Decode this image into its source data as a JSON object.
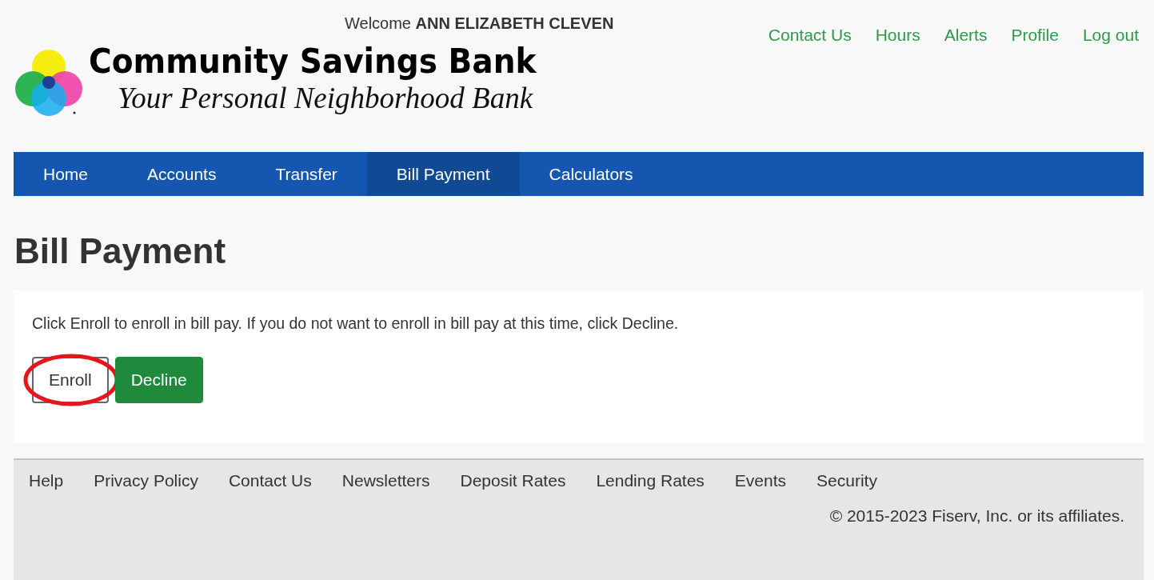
{
  "header": {
    "welcome": "Welcome **ANN ELIZABETH CLEVEN**",
    "links": [
      "Contact Us",
      "Hours",
      "Alerts",
      "Profile",
      "Log out"
    ],
    "bank_name": "Community Savings Bank",
    "tagline": "Your Personal Neighborhood Bank"
  },
  "nav": [
    {
      "label": "Home",
      "selected": false
    },
    {
      "label": "Accounts",
      "selected": false
    },
    {
      "label": "Transfer",
      "selected": false
    },
    {
      "label": "Bill Payment",
      "selected": true
    },
    {
      "label": "Calculators",
      "selected": false
    }
  ],
  "page_title": "Bill Payment",
  "message": "Click Enroll to enroll in bill pay. If you do not want to enroll in bill pay at this time, click Decline.",
  "buttons": [
    {
      "label": "Enroll",
      "kind": "outline",
      "circled": true
    },
    {
      "label": "Decline",
      "kind": "primary",
      "circled": false
    }
  ],
  "footer": {
    "links": [
      "Help",
      "Privacy Policy",
      "Contact Us",
      "Newsletters",
      "Deposit Rates",
      "Lending Rates",
      "Events",
      "Security"
    ],
    "copyright": "© 2015-2023 Fiserv, Inc. or its affiliates."
  }
}
